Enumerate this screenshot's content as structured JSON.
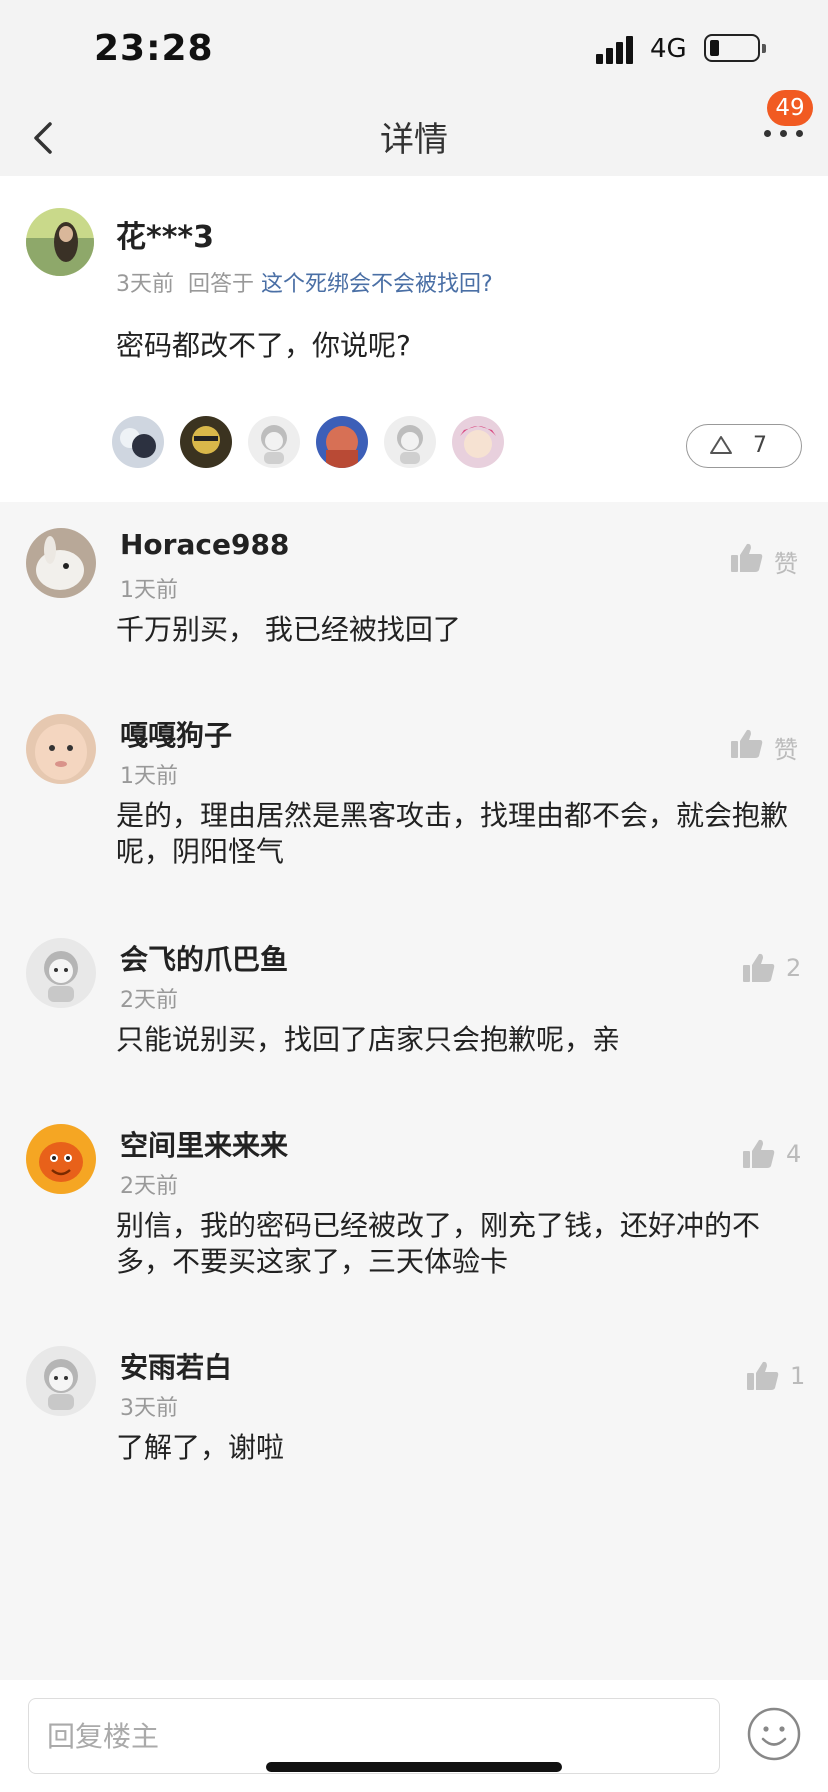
{
  "status_bar": {
    "time": "23:28",
    "network": "4G"
  },
  "nav": {
    "title": "详情",
    "badge": "49"
  },
  "post": {
    "author": "花***3",
    "time": "3天前",
    "reply_prefix": "回答于",
    "question": "这个死绑会不会被找回?",
    "text": "密码都改不了，你说呢?",
    "upvote_count": "7"
  },
  "comments": [
    {
      "name": "Horace988",
      "time": "1天前",
      "text": "千万别买， 我已经被找回了",
      "like": "赞"
    },
    {
      "name": "嘎嘎狗子",
      "time": "1天前",
      "text": "是的，理由居然是黑客攻击，找理由都不会，就会抱歉呢，阴阳怪气",
      "like": "赞"
    },
    {
      "name": "会飞的爪巴鱼",
      "time": "2天前",
      "text": "只能说别买，找回了店家只会抱歉呢，亲",
      "like": "2"
    },
    {
      "name": "空间里来来来",
      "time": "2天前",
      "text": " 别信，我的密码已经被改了，刚充了钱，还好冲的不多，不要买这家了，三天体验卡",
      "like": "4"
    },
    {
      "name": "安雨若白",
      "time": "3天前",
      "text": "了解了，谢啦",
      "like": "1"
    }
  ],
  "reply_bar": {
    "placeholder": "回复楼主"
  },
  "colors": {
    "badge": "#f15a22",
    "link": "#4a6fa5",
    "muted": "#999999"
  }
}
